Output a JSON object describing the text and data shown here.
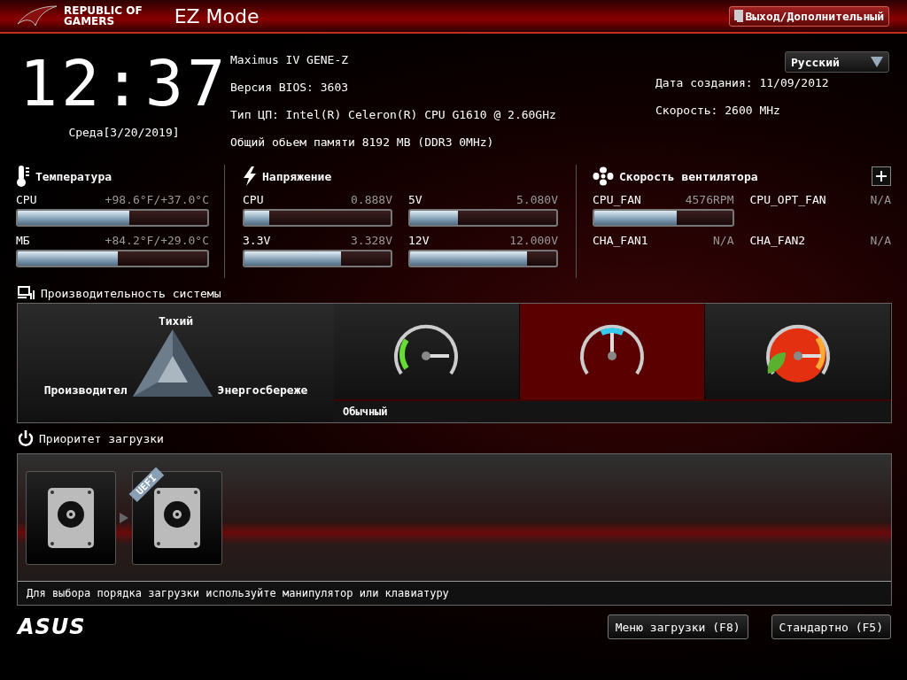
{
  "header": {
    "logo_line1": "REPUBLIC OF",
    "logo_line2": "GAMERS",
    "mode": "EZ Mode",
    "exit_button": "Выход/Дополнительный"
  },
  "clock": {
    "time": "12:37",
    "date": "Среда[3/20/2019]"
  },
  "system_info": {
    "left": [
      "Maximus IV GENE-Z",
      "Версия BIOS: 3603",
      "Тип ЦП: Intel(R) Celeron(R) CPU G1610 @ 2.60GHz",
      "Общий обьем памяти 8192 MB (DDR3 0MHz)"
    ],
    "language": "Русский",
    "right": [
      "Дата создания: 11/09/2012",
      "Скорость: 2600 MHz"
    ]
  },
  "temperature": {
    "title": "Температура",
    "items": [
      {
        "label": "CPU",
        "reading": "+98.6°F/+37.0°C",
        "level": 0.59
      },
      {
        "label": "МБ",
        "reading": "+84.2°F/+29.0°C",
        "level": 0.53
      }
    ]
  },
  "voltage": {
    "title": "Напряжение",
    "items": [
      {
        "label": "CPU",
        "reading": "0.888V",
        "level": 0.17
      },
      {
        "label": "5V",
        "reading": "5.080V",
        "level": 0.33
      },
      {
        "label": "3.3V",
        "reading": "3.328V",
        "level": 0.66
      },
      {
        "label": "12V",
        "reading": "12.000V",
        "level": 0.8
      }
    ]
  },
  "fans": {
    "title": "Скорость вентилятора",
    "items": [
      {
        "label": "CPU_FAN",
        "reading": "4576RPM",
        "level": 0.6
      },
      {
        "label": "CPU_OPT_FAN",
        "reading": "N/A"
      },
      {
        "label": "CHA_FAN1",
        "reading": "N/A"
      },
      {
        "label": "CHA_FAN2",
        "reading": "N/A"
      }
    ]
  },
  "performance": {
    "title": "Производительность системы",
    "top": "Тихий",
    "left": "Производител",
    "right": "Энергосбереже",
    "modes": [
      {
        "kind": "normal",
        "selected": false
      },
      {
        "kind": "quiet",
        "selected": true
      },
      {
        "kind": "turbo",
        "selected": false
      }
    ],
    "mode_label": "Обычный"
  },
  "boot": {
    "title": "Приоритет загрузки",
    "devices": [
      {
        "uefi": false
      },
      {
        "uefi": true
      }
    ],
    "uefi_label": "UEFI",
    "hint": "Для выбора порядка загрузки используйте манипулятор или клавиатуру"
  },
  "footer": {
    "brand": "ASUS",
    "buttons": [
      "Меню загрузки (F8)",
      "Стандартно (F5)"
    ]
  }
}
